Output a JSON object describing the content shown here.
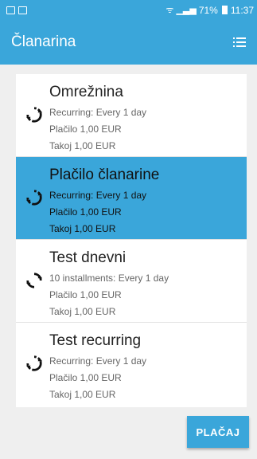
{
  "status_bar": {
    "battery": "71%",
    "time": "11:37"
  },
  "app_bar": {
    "title": "Članarina",
    "menu_icon": "list-icon"
  },
  "items": [
    {
      "title": "Omrežnina",
      "line1": "Recurring: Every 1 day",
      "line2": "Plačilo 1,00 EUR",
      "line3": "Takoj 1,00 EUR",
      "selected": false
    },
    {
      "title": "Plačilo članarine",
      "line1": "Recurring: Every 1 day",
      "line2": "Plačilo 1,00 EUR",
      "line3": "Takoj 1,00 EUR",
      "selected": true
    },
    {
      "title": "Test dnevni",
      "line1": "10 installments: Every 1 day",
      "line2": "Plačilo 1,00 EUR",
      "line3": "Takoj 1,00 EUR",
      "selected": false
    },
    {
      "title": "Test recurring",
      "line1": "Recurring: Every 1 day",
      "line2": "Plačilo 1,00 EUR",
      "line3": "Takoj 1,00 EUR",
      "selected": false
    }
  ],
  "pay_button": {
    "label": "PLAČAJ"
  },
  "colors": {
    "accent": "#3aa6da",
    "background": "#efefef"
  }
}
